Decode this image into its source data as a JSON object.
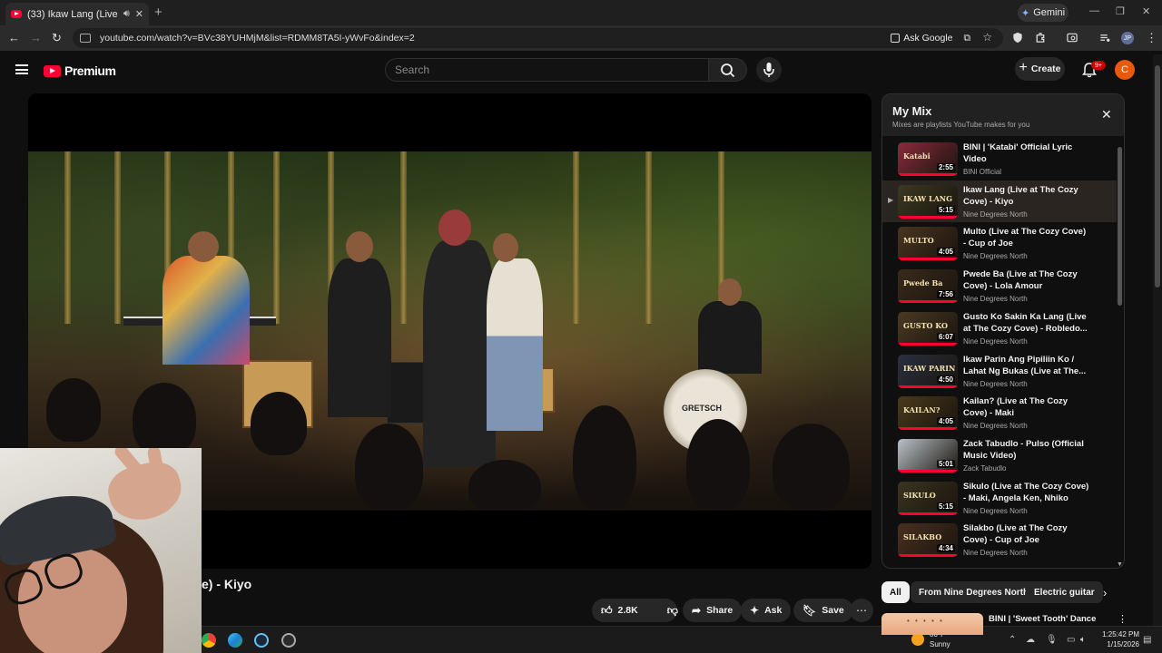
{
  "browser": {
    "tab_title": "(33) Ikaw Lang (Live at The",
    "new_tab": "+",
    "gemini_label": "Gemini",
    "url": "youtube.com/watch?v=BVc38YUHMjM&list=RDMM8TA5I-yWvFo&index=2",
    "ask_google": "Ask Google",
    "profile_initials": "JP",
    "window_controls": [
      "—",
      "❐",
      "✕"
    ]
  },
  "youtube": {
    "logo_word": "Premium",
    "search_placeholder": "Search",
    "create_label": "Create",
    "notification_badge": "9+",
    "avatar_letter": "C"
  },
  "video": {
    "title_visible": "e) - Kiyo",
    "drum_brand": "GRETSCH",
    "likes": "2.8K",
    "share_label": "Share",
    "ask_label": "Ask",
    "save_label": "Save"
  },
  "mix": {
    "title": "My Mix",
    "subtitle": "Mixes are playlists YouTube makes for you",
    "items": [
      {
        "title": "BINI | 'Katabi' Official Lyric Video",
        "channel": "BINI Official",
        "duration": "2:55",
        "thumb_caption": "Katabi",
        "thumb_color": "#8a2a3c",
        "active": false
      },
      {
        "title": "Ikaw Lang (Live at The Cozy Cove) - Kiyo",
        "channel": "Nine Degrees North",
        "duration": "5:15",
        "thumb_caption": "IKAW LANG",
        "thumb_color": "#3b3a22",
        "active": true
      },
      {
        "title": "Multo (Live at The Cozy Cove) - Cup of Joe",
        "channel": "Nine Degrees North",
        "duration": "4:05",
        "thumb_caption": "MULTO",
        "thumb_color": "#4a3520",
        "active": false
      },
      {
        "title": "Pwede Ba (Live at The Cozy Cove) - Lola Amour",
        "channel": "Nine Degrees North",
        "duration": "7:56",
        "thumb_caption": "Pwede Ba",
        "thumb_color": "#3a2a1a",
        "active": false
      },
      {
        "title": "Gusto Ko Sakin Ka Lang (Live at The Cozy Cove) - Robledo...",
        "channel": "Nine Degrees North",
        "duration": "6:07",
        "thumb_caption": "GUSTO KO",
        "thumb_color": "#4a3a22",
        "active": false
      },
      {
        "title": "Ikaw Parin Ang Pipiliin Ko / Lahat Ng Bukas (Live at The...",
        "channel": "Nine Degrees North",
        "duration": "4:50",
        "thumb_caption": "IKAW PARIN",
        "thumb_color": "#2a3040",
        "active": false
      },
      {
        "title": "Kailan? (Live at The Cozy Cove) - Maki",
        "channel": "Nine Degrees North",
        "duration": "4:05",
        "thumb_caption": "KAILAN?",
        "thumb_color": "#4a3a1c",
        "active": false
      },
      {
        "title": "Zack Tabudlo - Pulso (Official Music Video)",
        "channel": "Zack Tabudlo",
        "duration": "5:01",
        "thumb_caption": "",
        "thumb_color": "#b9c2c8",
        "active": false
      },
      {
        "title": "Sikulo (Live at The Cozy Cove) - Maki, Angela Ken, Nhiko",
        "channel": "Nine Degrees North",
        "duration": "5:15",
        "thumb_caption": "SIKULO",
        "thumb_color": "#3a3420",
        "active": false
      },
      {
        "title": "Silakbo (Live at The Cozy Cove) - Cup of Joe",
        "channel": "Nine Degrees North",
        "duration": "4:34",
        "thumb_caption": "SILAKBO",
        "thumb_color": "#4a3020",
        "active": false
      }
    ]
  },
  "chips": [
    "All",
    "From Nine Degrees North",
    "Electric guitar"
  ],
  "next_rec_title": "BINI | 'Sweet Tooth' Dance",
  "taskbar": {
    "temp": "80°F",
    "condition": "Sunny",
    "time": "1:25:42 PM",
    "date": "1/15/2026"
  }
}
